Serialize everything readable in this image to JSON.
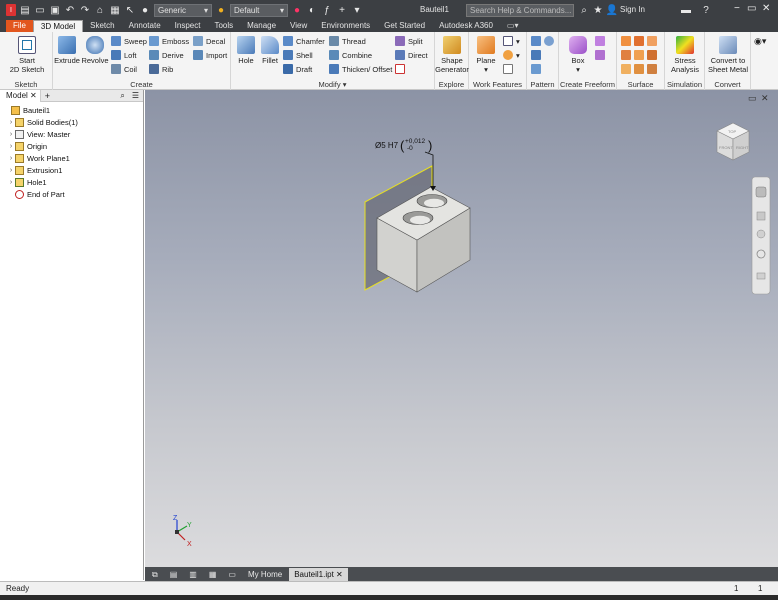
{
  "titlebar": {
    "material": "Generic",
    "appearance": "Default",
    "doc_title": "Bauteil1",
    "search_placeholder": "Search Help & Commands...",
    "signin": "Sign In",
    "help": "?"
  },
  "tabs": [
    "File",
    "3D Model",
    "Sketch",
    "Annotate",
    "Inspect",
    "Tools",
    "Manage",
    "View",
    "Environments",
    "Get Started",
    "Autodesk A360"
  ],
  "active_tab": "3D Model",
  "ribbon": {
    "sketch": {
      "label": "Sketch",
      "start_line1": "Start",
      "start_line2": "2D Sketch"
    },
    "create": {
      "label": "Create",
      "extrude": "Extrude",
      "revolve": "Revolve",
      "sweep": "Sweep",
      "loft": "Loft",
      "coil": "Coil",
      "emboss": "Emboss",
      "derive": "Derive",
      "rib": "Rib",
      "decal": "Decal",
      "import": "Import"
    },
    "modify": {
      "label": "Modify",
      "hole": "Hole",
      "fillet": "Fillet",
      "chamfer": "Chamfer",
      "shell": "Shell",
      "draft": "Draft",
      "thread": "Thread",
      "combine": "Combine",
      "thicken": "Thicken/ Offset",
      "split": "Split",
      "direct": "Direct"
    },
    "explore": {
      "label": "Explore",
      "shape_line1": "Shape",
      "shape_line2": "Generator"
    },
    "work_features": {
      "label": "Work Features",
      "plane": "Plane"
    },
    "pattern": {
      "label": "Pattern"
    },
    "freeform": {
      "label": "Create Freeform",
      "box": "Box"
    },
    "surface": {
      "label": "Surface"
    },
    "simulation": {
      "label": "Simulation",
      "stress_line1": "Stress",
      "stress_line2": "Analysis"
    },
    "convert": {
      "label": "Convert",
      "line1": "Convert to",
      "line2": "Sheet Metal"
    }
  },
  "browser": {
    "tab": "Model",
    "tree": [
      {
        "label": "Bauteil1",
        "indent": 0,
        "expand": ""
      },
      {
        "label": "Solid Bodies(1)",
        "indent": 1,
        "expand": "›"
      },
      {
        "label": "View: Master",
        "indent": 1,
        "expand": "›"
      },
      {
        "label": "Origin",
        "indent": 1,
        "expand": "›"
      },
      {
        "label": "Work Plane1",
        "indent": 1,
        "expand": "›"
      },
      {
        "label": "Extrusion1",
        "indent": 1,
        "expand": "›"
      },
      {
        "label": "Hole1",
        "indent": 1,
        "expand": "›"
      },
      {
        "label": "End of Part",
        "indent": 1,
        "expand": ""
      }
    ]
  },
  "viewport": {
    "annotation_main": "Ø5 H7",
    "tol_upper": "+0,012",
    "tol_lower": "-0",
    "viewcube_front": "FRONT",
    "viewcube_right": "RIGHT",
    "viewcube_top": "TOP",
    "axis_x": "X",
    "axis_y": "Y",
    "axis_z": "Z"
  },
  "doctabs": {
    "home": "My Home",
    "part": "Bauteil1.ipt"
  },
  "status": {
    "text": "Ready",
    "count1": "1",
    "count2": "1"
  },
  "colors": {
    "file_tab": "#e2561e",
    "titlebar": "#3c3f43",
    "edge_highlight": "#e8e020"
  }
}
